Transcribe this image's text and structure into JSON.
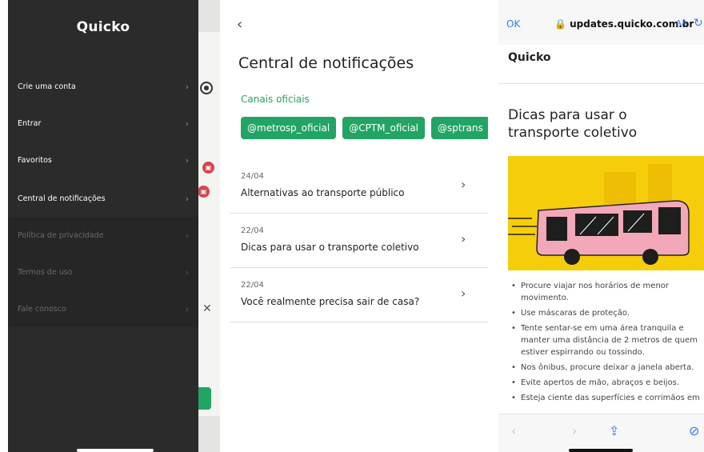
{
  "menu": {
    "brand": "Quicko",
    "items": [
      {
        "label": "Crie uma conta",
        "enabled": true
      },
      {
        "label": "Entrar",
        "enabled": true
      },
      {
        "label": "Favoritos",
        "enabled": true
      },
      {
        "label": "Central de notificações",
        "enabled": true
      },
      {
        "label": "Política de privacidade",
        "enabled": false
      },
      {
        "label": "Termos de uso",
        "enabled": false
      },
      {
        "label": "Fale conosco",
        "enabled": false
      }
    ],
    "chevron": "›"
  },
  "notifications": {
    "back_icon": "‹",
    "title": "Central de notificações",
    "channels_label": "Canais oficiais",
    "channels": [
      "@metrosp_oficial",
      "@CPTM_oficial",
      "@sptrans"
    ],
    "items": [
      {
        "date": "24/04",
        "title": "Alternativas ao transporte público"
      },
      {
        "date": "22/04",
        "title": "Dicas para usar o transporte coletivo"
      },
      {
        "date": "22/04",
        "title": "Você realmente precisa sair de casa?"
      }
    ],
    "chevron": "›"
  },
  "browser": {
    "done_label": "OK",
    "url": "🔒 updates.quicko.com.br",
    "text_size_label": "AA",
    "reload_icon": "↻",
    "brand": "Quicko",
    "article_title": "Dicas para usar o transporte coletivo",
    "bullets": [
      "Procure viajar nos horários de menor movimento.",
      "Use máscaras de proteção.",
      "Tente sentar-se em uma área tranquila e manter uma distância de 2 metros de quem estiver espirrando ou tossindo.",
      "Nos ônibus, procure deixar a janela aberta.",
      "Evite apertos de mão, abraços e beijos.",
      "Esteja ciente das superfícies e corrimãos em"
    ],
    "toolbar": {
      "back": "‹",
      "forward": "›",
      "share": "⇪",
      "compass": "⊘"
    }
  },
  "colors": {
    "accent_green": "#22a564",
    "menu_bg": "#2b2b2b",
    "hero_yellow": "#f6cd0a",
    "bus_pink": "#f2a8b8",
    "link_blue": "#2f7cf6"
  }
}
